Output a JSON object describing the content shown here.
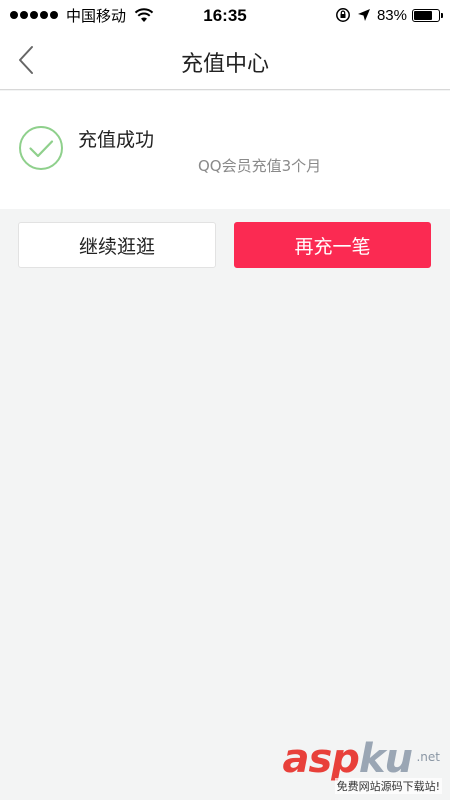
{
  "status_bar": {
    "carrier": "中国移动",
    "time": "16:35",
    "battery": "83%",
    "battery_level": 0.83
  },
  "nav": {
    "title": "充值中心",
    "back_icon": "chevron-left-icon"
  },
  "result": {
    "title": "充值成功",
    "description": "QQ会员充值3个月",
    "icon": "check-circle-icon",
    "icon_color": "#8fd08c"
  },
  "actions": {
    "continue_label": "继续逛逛",
    "recharge_label": "再充一笔",
    "accent_color": "#fb2a52"
  },
  "watermark": {
    "logo_asp": "asp",
    "logo_ku": "ku",
    "domain": ".net",
    "subtitle": "免费网站源码下载站!"
  }
}
